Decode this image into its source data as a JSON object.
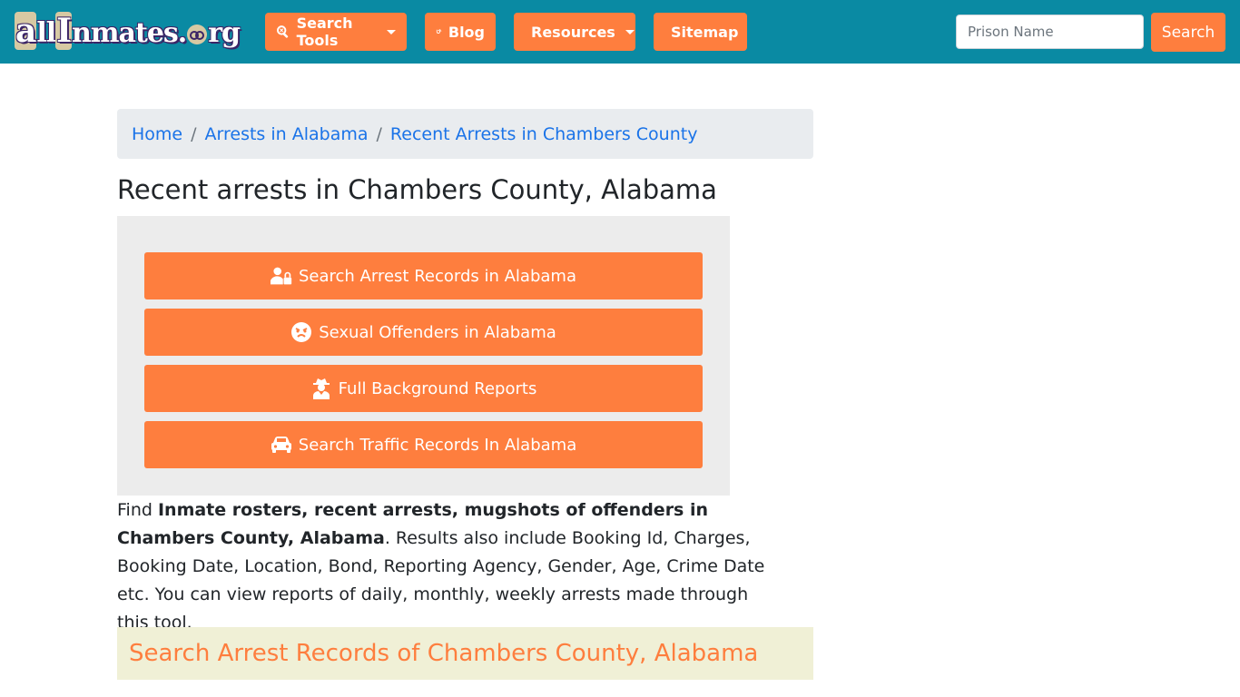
{
  "navbar": {
    "logo": {
      "part1": "a",
      "part2": "ll",
      "part3": "I",
      "part4": "nmates.",
      "part5": "rg"
    },
    "items": [
      {
        "label": "Search Tools",
        "icon": "search-icon",
        "dropdown": true
      },
      {
        "label": "Blog",
        "icon": "blogger-icon",
        "dropdown": false
      },
      {
        "label": "Resources",
        "icon": "leaf-icon",
        "dropdown": true
      },
      {
        "label": "Sitemap",
        "icon": "rss-icon",
        "dropdown": false
      }
    ],
    "search": {
      "placeholder": "Prison Name",
      "value": "",
      "button_label": "Search"
    }
  },
  "breadcrumb": {
    "items": [
      {
        "label": "Home"
      },
      {
        "label": "Arrests in Alabama"
      },
      {
        "label": "Recent Arrests in Chambers County"
      }
    ],
    "separator": "/"
  },
  "main": {
    "title": "Recent arrests in Chambers County, Alabama",
    "actions": [
      {
        "label": "Search Arrest Records in Alabama",
        "icon": "user-lock-icon"
      },
      {
        "label": "Sexual Offenders in Alabama",
        "icon": "angry-face-icon"
      },
      {
        "label": "Full Background Reports",
        "icon": "user-secret-icon"
      },
      {
        "label": "Search Traffic Records In Alabama",
        "icon": "car-icon"
      }
    ],
    "description": {
      "lead": "Find ",
      "bold": "Inmate rosters, recent arrests, mugshots of offenders in Chambers County, Alabama",
      "rest": ". Results also include Booking Id, Charges, Booking Date, Location, Bond, Reporting Agency, Gender, Age, Crime Date etc. You can view reports of daily, monthly, weekly arrests made through this tool."
    },
    "section_heading": "Search Arrest Records of Chambers County, Alabama"
  },
  "colors": {
    "navbar_bg": "#0a8aa3",
    "accent_orange": "#fe7e3e",
    "link_blue": "#1a73e8",
    "breadcrumb_bg": "#e9ecef",
    "panel_bg": "#ececec",
    "section_bg": "#f0f0d6"
  }
}
